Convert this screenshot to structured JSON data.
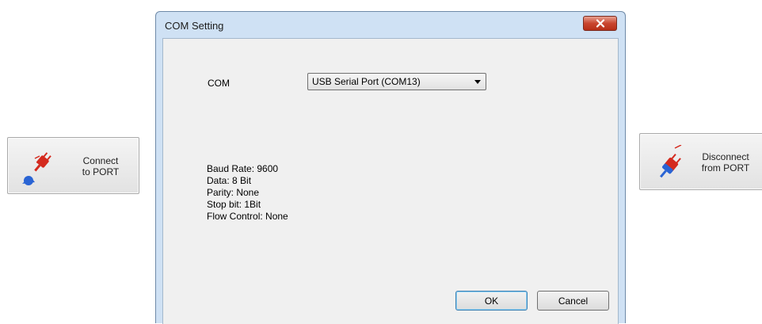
{
  "left_button": {
    "label_line1": "Connect",
    "label_line2": "to PORT",
    "icon": "plug-connect-icon"
  },
  "right_button": {
    "label_line1": "Disconnect",
    "label_line2": "from PORT",
    "icon": "plug-disconnect-icon"
  },
  "dialog": {
    "title": "COM Setting",
    "close_icon": "close-icon",
    "com_label": "COM",
    "com_selected": "USB Serial Port (COM13)",
    "settings": [
      "Baud Rate: 9600",
      "Data: 8 Bit",
      "Parity: None",
      "Stop bit: 1Bit",
      "Flow Control: None"
    ],
    "ok_label": "OK",
    "cancel_label": "Cancel"
  },
  "colors": {
    "plug_red": "#d42a1e",
    "plug_blue": "#2a64d4",
    "close_red": "#c9452f",
    "frame_blue": "#cfe1f4"
  }
}
